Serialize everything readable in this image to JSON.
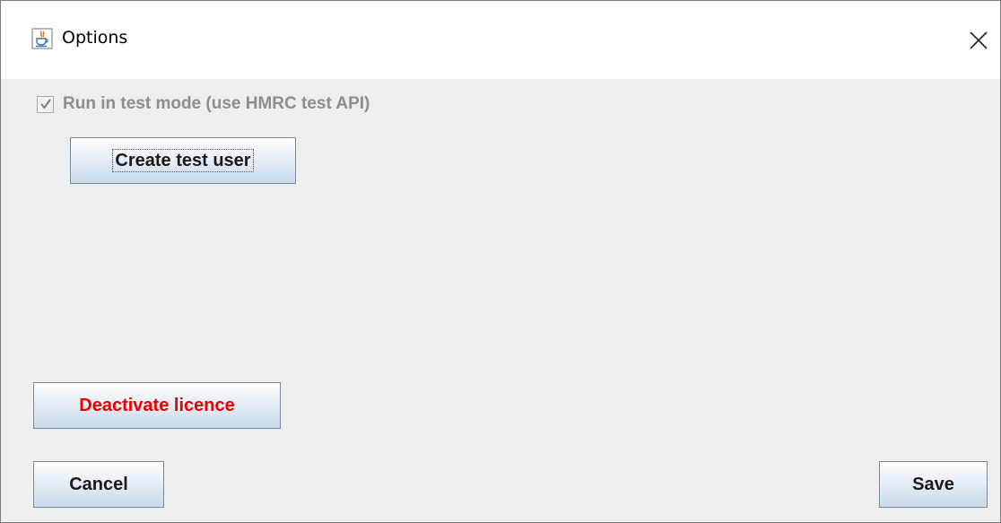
{
  "window": {
    "title": "Options",
    "icon": "java-cup-icon",
    "close_icon": "close-icon"
  },
  "options": {
    "test_mode": {
      "label": "Run in test mode (use HMRC test API)",
      "checked": true,
      "enabled": false
    },
    "create_test_user_label": "Create test user"
  },
  "actions": {
    "deactivate_label": "Deactivate licence",
    "deactivate_color": "#e60000",
    "cancel_label": "Cancel",
    "save_label": "Save"
  }
}
